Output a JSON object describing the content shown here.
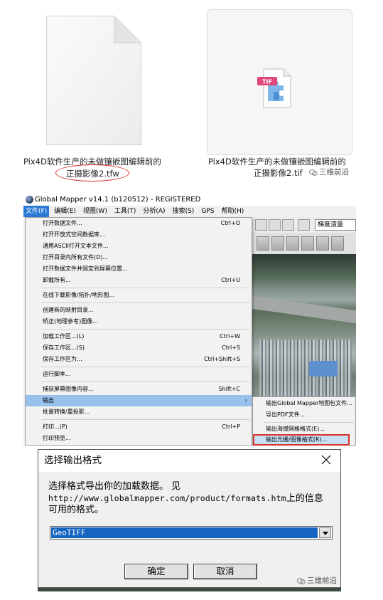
{
  "files": {
    "tfw": {
      "caption_line1": "Pix4D软件生产的未做镶嵌图编辑前的",
      "caption_line2": "正摄影像2.tfw",
      "highlight_color": "#d9342b"
    },
    "tif": {
      "badge": "TIF",
      "caption_line1": "Pix4D软件生产的未做镶嵌图编辑前的",
      "caption_line2": "正摄影像2.tif"
    },
    "watermark": "三维前沿"
  },
  "global_mapper": {
    "title": "Global Mapper v14.1 (b120512) - REGISTERED",
    "menubar": [
      "文件(F)",
      "编辑(E)",
      "视图(W)",
      "工具(T)",
      "分析(A)",
      "搜索(S)",
      "GPS",
      "帮助(H)"
    ],
    "active_menu": "文件(F)",
    "projection_box": "梯度渲量",
    "file_menu": [
      {
        "label": "打开数据文件...",
        "shortcut": "Ctrl+O"
      },
      {
        "label": "打开开放式空间数据库...",
        "shortcut": ""
      },
      {
        "label": "通用ASCII打开文本文件...",
        "shortcut": ""
      },
      {
        "label": "打开目录内所有文件(D)...",
        "shortcut": ""
      },
      {
        "label": "打开数据文件并固定到屏幕位置...",
        "shortcut": ""
      },
      {
        "label": "卸载所有...",
        "shortcut": "Ctrl+U"
      },
      {
        "label": "在线下载影像/拓扑/地形图...",
        "shortcut": ""
      },
      {
        "label": "创建新的映射目录...",
        "shortcut": ""
      },
      {
        "label": "矫正(地理参考)图像...",
        "shortcut": ""
      },
      {
        "label": "加载工作区...(L)",
        "shortcut": "Ctrl+W"
      },
      {
        "label": "保存工作区...(S)",
        "shortcut": "Ctrl+S"
      },
      {
        "label": "保存工作区为...",
        "shortcut": "Ctrl+Shift+S"
      },
      {
        "label": "运行脚本...",
        "shortcut": ""
      },
      {
        "label": "捕获屏幕图像内容...",
        "shortcut": "Shift+C"
      },
      {
        "label": "输出",
        "shortcut": ""
      },
      {
        "label": "批量转换/重投影...",
        "shortcut": ""
      },
      {
        "label": "打印...(P)",
        "shortcut": "Ctrl+P"
      },
      {
        "label": "打印预览...",
        "shortcut": ""
      }
    ],
    "export_submenu": [
      "输出Global Mapper地图包文件...",
      "导出PDF文件...",
      "输出海拔网格格式(E)...",
      "输出光栅/图像格式(R)..."
    ]
  },
  "dialog": {
    "title": "选择输出格式",
    "message_line1": "选择格式导出你的加载数据。 见",
    "message_url": "http://www.globalmapper.com/product/formats.htm",
    "message_line2_suffix": "上的信息",
    "message_line3": "可用的格式。",
    "selected_format": "GeoTIFF",
    "ok_label": "确定",
    "cancel_label": "取消"
  }
}
